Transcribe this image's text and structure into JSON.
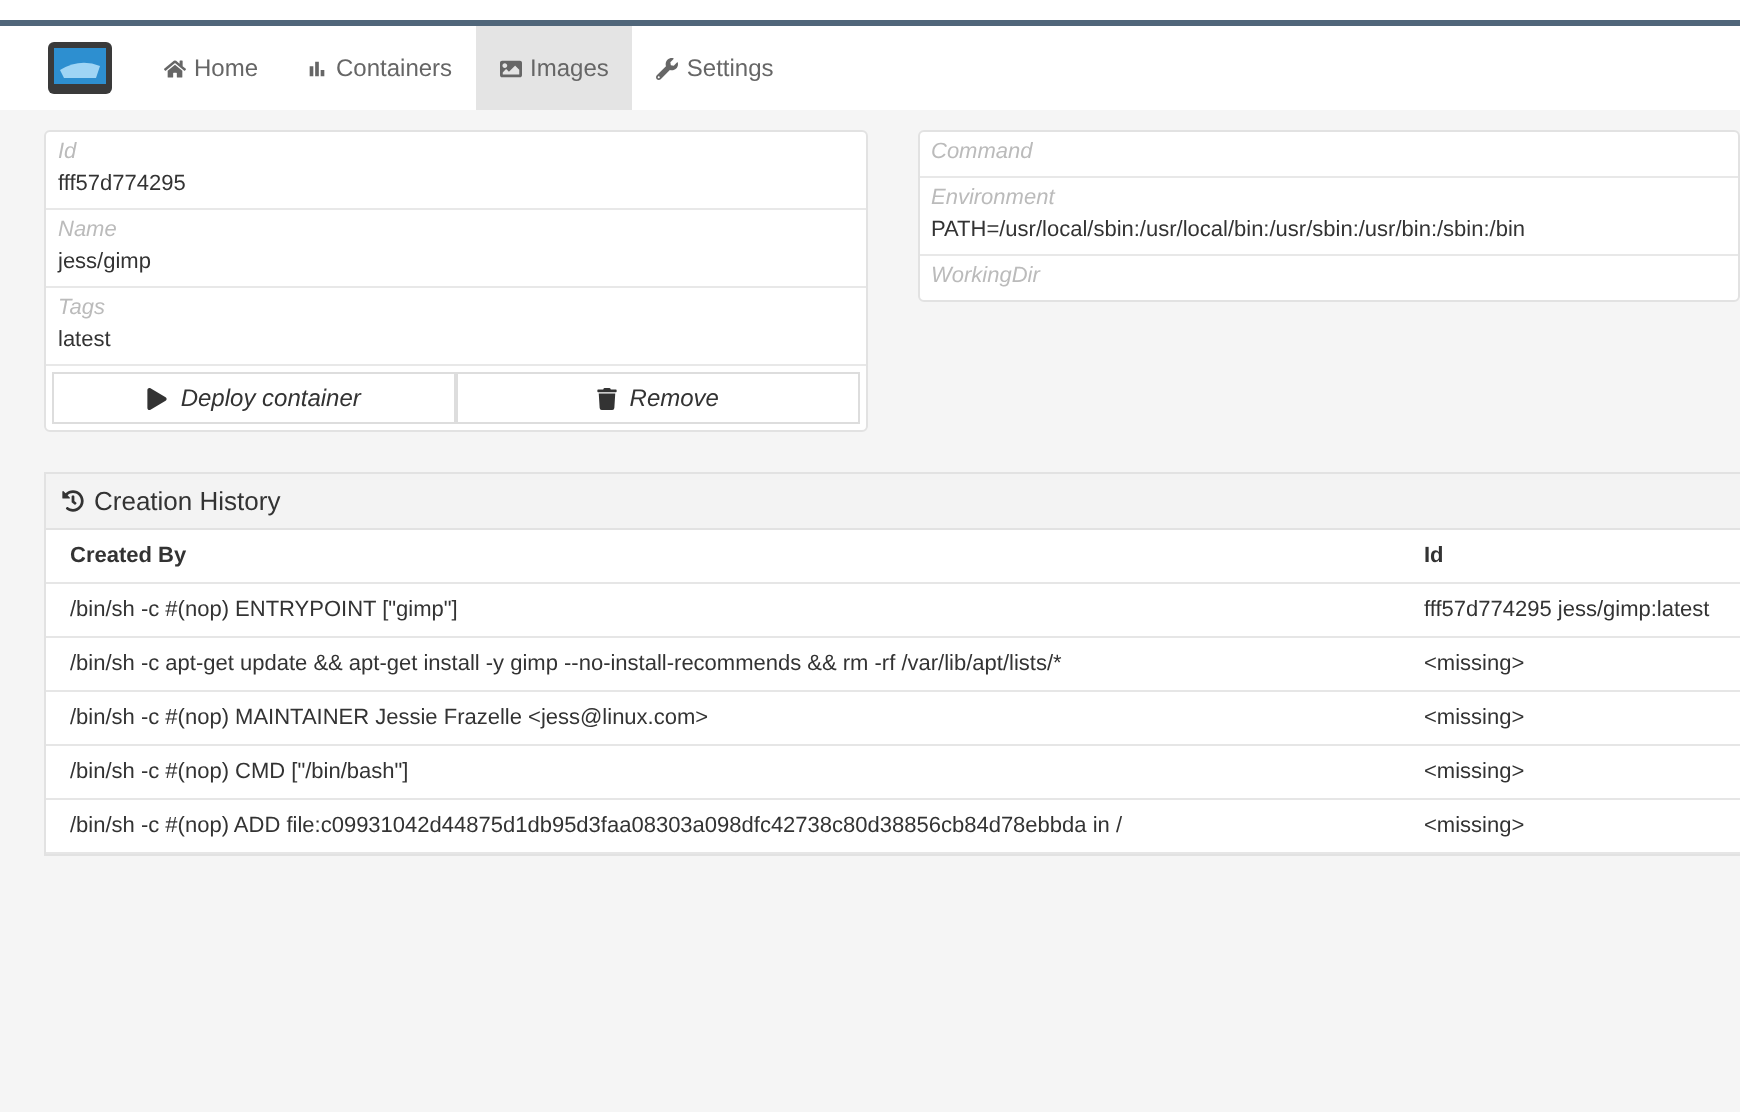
{
  "nav": {
    "tabs": [
      {
        "label": "Home",
        "kind": "home",
        "selected": false
      },
      {
        "label": "Containers",
        "kind": "chart",
        "selected": false
      },
      {
        "label": "Images",
        "kind": "image",
        "selected": true
      },
      {
        "label": "Settings",
        "kind": "wrench",
        "selected": false
      }
    ]
  },
  "image_details": {
    "fields": [
      {
        "label": "Id",
        "value": "fff57d774295"
      },
      {
        "label": "Name",
        "value": "jess/gimp"
      },
      {
        "label": "Tags",
        "value": "latest"
      }
    ],
    "buttons": [
      {
        "label": "Deploy container",
        "kind": "play"
      },
      {
        "label": "Remove",
        "kind": "trash"
      }
    ]
  },
  "config": {
    "fields": [
      {
        "label": "Command"
      },
      {
        "label": "Environment",
        "value": "PATH=/usr/local/sbin:/usr/local/bin:/usr/sbin:/usr/bin:/sbin:/bin"
      },
      {
        "label": "WorkingDir"
      }
    ]
  },
  "history": {
    "title": "Creation History",
    "columns": [
      "Created By",
      "Id"
    ],
    "rows": [
      [
        "/bin/sh -c #(nop) ENTRYPOINT [\"gimp\"]",
        "fff57d774295 jess/gimp:latest"
      ],
      [
        "/bin/sh -c apt-get update && apt-get install -y gimp --no-install-recommends && rm -rf /var/lib/apt/lists/*",
        "<missing>"
      ],
      [
        "/bin/sh -c #(nop) MAINTAINER Jessie Frazelle <jess@linux.com>",
        "<missing>"
      ],
      [
        "/bin/sh -c #(nop) CMD [\"/bin/bash\"]",
        "<missing>"
      ],
      [
        "/bin/sh -c #(nop) ADD file:c09931042d44875d1db95d3faa08303a098dfc42738c80d38856cb84d78ebbda in /",
        "<missing>"
      ]
    ]
  }
}
